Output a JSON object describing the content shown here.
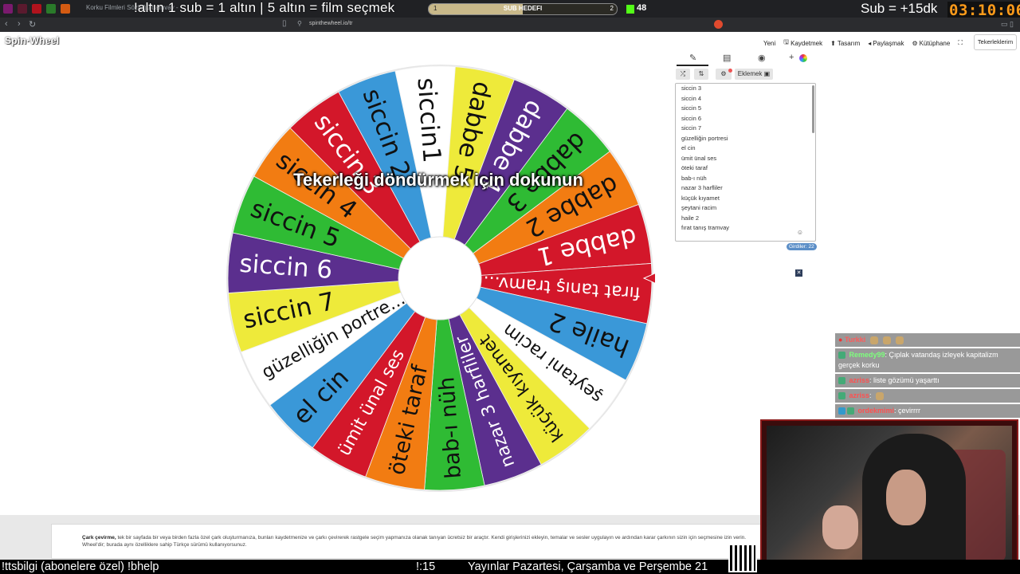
{
  "stream_overlay": {
    "browser_tab_text": "Korku Filmleri Sözlüğü                                              tramvay - ",
    "left_text": "!altın   1 sub = 1 altın | 5 altın = film seçmek",
    "goal": {
      "label": "SUB HEDEFI",
      "current": "1",
      "max": "2",
      "progress": 0.5
    },
    "viewers": "48",
    "right_text": "Sub = +15dk",
    "timer": "03:10:06"
  },
  "browser": {
    "url": "spinthewheel.io/tr"
  },
  "app": {
    "logo": "Spin·Wheel",
    "menu": [
      {
        "icon": "",
        "label": "Yeni"
      },
      {
        "icon": "save-icon",
        "label": "Kaydetmek"
      },
      {
        "icon": "palette-icon",
        "label": "Tasarım"
      },
      {
        "icon": "share-icon",
        "label": "Paylaşmak"
      },
      {
        "icon": "library-icon",
        "label": "Kütüphane"
      }
    ],
    "my_wheels": "Tekerleklerim",
    "spin_prompt": "Tekerleği döndürmek için dokunun",
    "panel": {
      "add_button": "Eklemek",
      "entries": [
        "siccin 3",
        "siccin 4",
        "siccin 5",
        "siccin 6",
        "siccin 7",
        "güzelliğin portresi",
        "el cin",
        "ümit ünal ses",
        "öteki taraf",
        "bab-ı nüh",
        "nazar 3 harfliler",
        "küçük kıyamet",
        "şeytani racim",
        "haile 2",
        "fırat tanış tramvay"
      ],
      "count_badge": "Girdiler: 22"
    },
    "footer": {
      "bold": "Çark çevirme,",
      "text": " tek bir sayfada bir veya birden fazla özel çark oluşturmanıza, bunları kaydetmenize ve çarkı çevirerek rastgele seçim yapmanıza olanak tanıyan ücretsiz bir araçtır. Kendi girişlerinizi ekleyin, temalar ve sesler uygulayın ve ardından karar çarkının sizin için seçmesine izin verin.",
      "text2": "Wheel'dir; burada aynı özelliklere sahip Türkçe sürümü kullanıyorsunuz."
    }
  },
  "wheel": {
    "segments": [
      {
        "label": "siccin1",
        "color": "#ffffff",
        "text_color": "#111111"
      },
      {
        "label": "dabbe 5",
        "color": "#eeea3a",
        "text_color": "#111111"
      },
      {
        "label": "dabbe 4",
        "color": "#5b2f8e",
        "text_color": "#ffffff"
      },
      {
        "label": "dabbe 3",
        "color": "#2fbb34",
        "text_color": "#111111"
      },
      {
        "label": "dabbe 2",
        "color": "#f27c12",
        "text_color": "#111111"
      },
      {
        "label": "dabbe 1",
        "color": "#d3172a",
        "text_color": "#ffffff"
      },
      {
        "label": "fırat tanış tramv...",
        "color": "#d3172a",
        "text_color": "#ffffff"
      },
      {
        "label": "haile 2",
        "color": "#3a98d8",
        "text_color": "#111111"
      },
      {
        "label": "şeytani racim",
        "color": "#ffffff",
        "text_color": "#111111"
      },
      {
        "label": "küçük kıyamet",
        "color": "#eeea3a",
        "text_color": "#111111"
      },
      {
        "label": "nazar 3 harfliler",
        "color": "#5b2f8e",
        "text_color": "#ffffff"
      },
      {
        "label": "bab-ı nüh",
        "color": "#2fbb34",
        "text_color": "#111111"
      },
      {
        "label": "öteki taraf",
        "color": "#f27c12",
        "text_color": "#111111"
      },
      {
        "label": "ümit ünal ses",
        "color": "#d3172a",
        "text_color": "#ffffff"
      },
      {
        "label": "el cin",
        "color": "#3a98d8",
        "text_color": "#111111"
      },
      {
        "label": "güzelliğin portre...",
        "color": "#ffffff",
        "text_color": "#111111"
      },
      {
        "label": "siccin 7",
        "color": "#eeea3a",
        "text_color": "#111111"
      },
      {
        "label": "siccin 6",
        "color": "#5b2f8e",
        "text_color": "#ffffff"
      },
      {
        "label": "siccin 5",
        "color": "#2fbb34",
        "text_color": "#111111"
      },
      {
        "label": "siccin 4",
        "color": "#f27c12",
        "text_color": "#111111"
      },
      {
        "label": "siccin 3",
        "color": "#d3172a",
        "text_color": "#ffffff"
      },
      {
        "label": "siccin 2",
        "color": "#3a98d8",
        "text_color": "#111111"
      }
    ],
    "pointer_color": "#d3172a"
  },
  "chat": [
    {
      "name": "Turkki",
      "name_color": "#ff5a5a",
      "message": ""
    },
    {
      "name": "Remedy99",
      "name_color": "#7dff7d",
      "message": ": Çıplak vatandaş izleyek kapitalizm gerçek korku"
    },
    {
      "name": "azriss",
      "name_color": "#ff5050",
      "message": ": liste gözümü yaşarttı"
    },
    {
      "name": "azriss",
      "name_color": "#ff5050",
      "message": ":"
    },
    {
      "name": "ordekmimi",
      "name_color": "#ff5050",
      "message": ": çevirrrr"
    }
  ],
  "ticker": {
    "left": "!ttsbilgi (abonelere özel)      !bhelp",
    "mid": "!:15",
    "right": "Yayınlar Pazartesi, Çarşamba ve Perşembe 21"
  }
}
